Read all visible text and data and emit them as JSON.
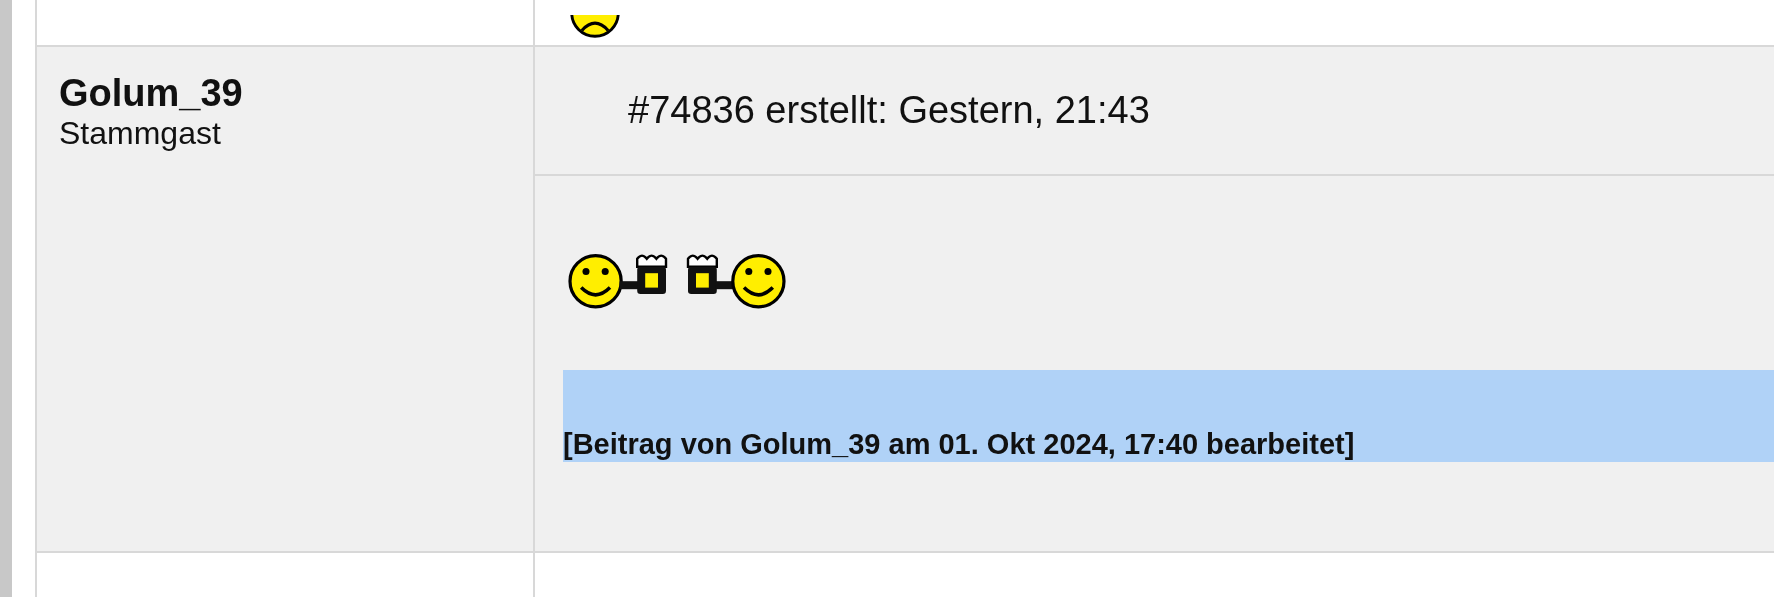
{
  "posts": [
    {
      "kind": "partial_top",
      "emoticons": [
        {
          "kind": "sad"
        }
      ]
    },
    {
      "kind": "post",
      "author": "Golum_39",
      "rank": "Stammgast",
      "header": "#74836 erstellt: Gestern, 21:43",
      "emoticons": [
        {
          "kind": "smiley-beer"
        },
        {
          "kind": "beer-smiley"
        }
      ],
      "edit_note": "[Beitrag von Golum_39 am 01. Okt 2024, 17:40 bearbeitet]",
      "edit_note_selected": true
    },
    {
      "kind": "partial_bottom"
    }
  ]
}
